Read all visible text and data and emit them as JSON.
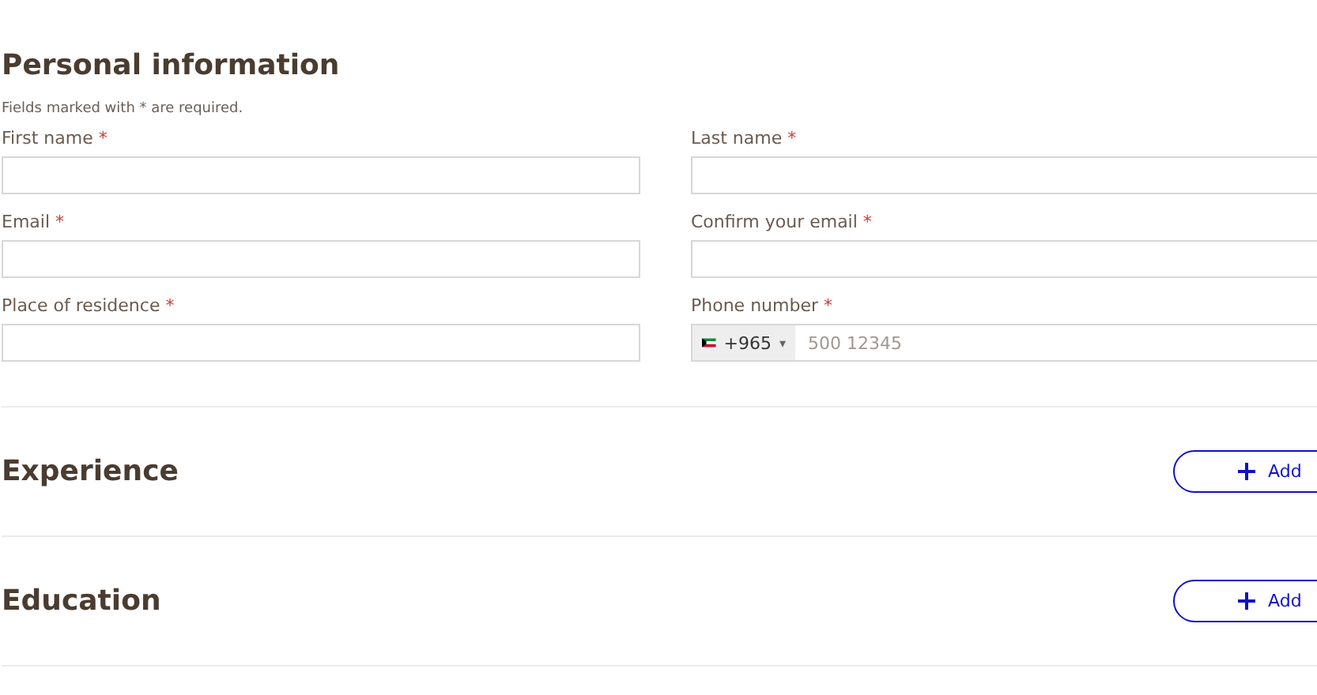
{
  "personal_information": {
    "title": "Personal information",
    "note": "Fields marked with * are required.",
    "fields": [
      {
        "label": "First name",
        "required_mark": "*",
        "kind": "text"
      },
      {
        "label": "Last name",
        "required_mark": "*",
        "kind": "text"
      },
      {
        "label": "Email",
        "required_mark": "*",
        "kind": "text"
      },
      {
        "label": "Confirm your email",
        "required_mark": "*",
        "kind": "text"
      },
      {
        "label": "Place of residence",
        "required_mark": "*",
        "kind": "text"
      },
      {
        "label": "Phone number",
        "required_mark": "*",
        "kind": "phone",
        "dial_code": "+965",
        "caret": "▾",
        "placeholder": "500 12345"
      }
    ]
  },
  "sections": [
    {
      "title": "Experience",
      "button": "Add"
    },
    {
      "title": "Education",
      "button": "Add"
    }
  ]
}
